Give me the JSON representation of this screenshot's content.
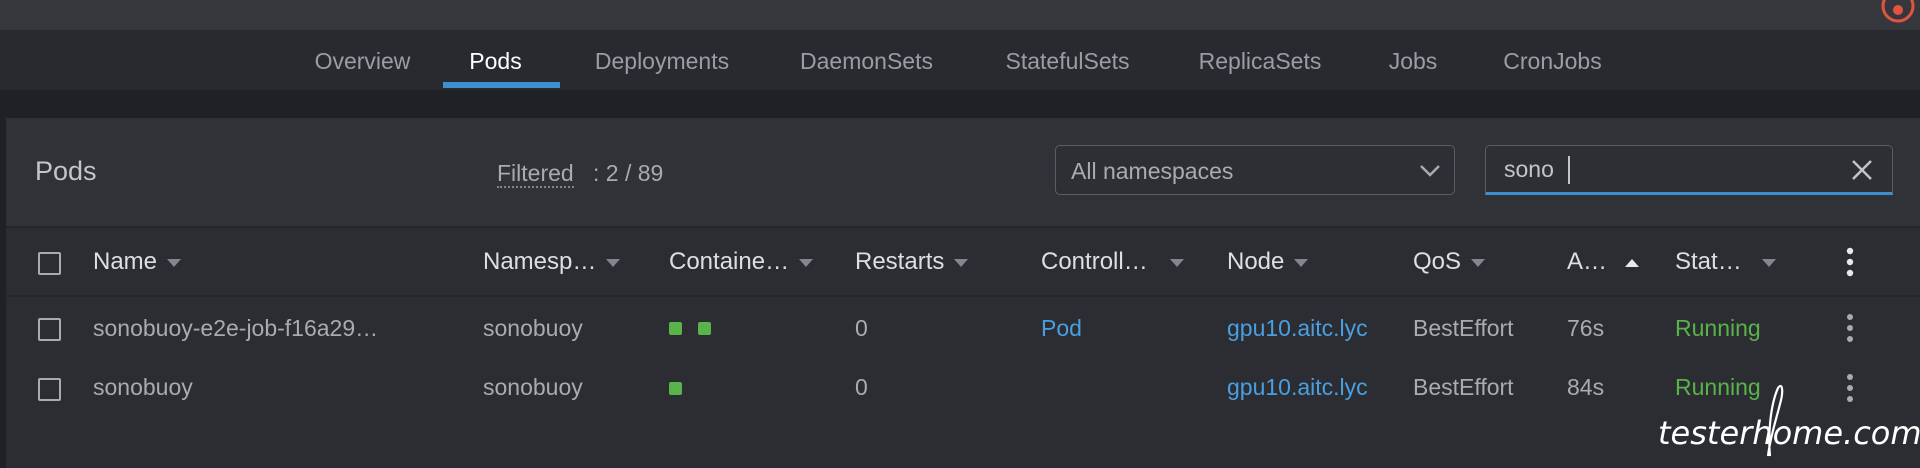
{
  "tabs": [
    {
      "label": "Overview"
    },
    {
      "label": "Pods"
    },
    {
      "label": "Deployments"
    },
    {
      "label": "DaemonSets"
    },
    {
      "label": "StatefulSets"
    },
    {
      "label": "ReplicaSets"
    },
    {
      "label": "Jobs"
    },
    {
      "label": "CronJobs"
    }
  ],
  "active_tab": "Pods",
  "panel": {
    "title": "Pods",
    "filter_label": "Filtered",
    "filter_count": ": 2 / 89",
    "namespace_select": "All namespaces",
    "search_value": "sono"
  },
  "table": {
    "columns": [
      {
        "label": "Name",
        "sort": "none"
      },
      {
        "label": "Namesp…",
        "sort": "none"
      },
      {
        "label": "Containe…",
        "sort": "none"
      },
      {
        "label": "Restarts",
        "sort": "none"
      },
      {
        "label": "Controll…",
        "sort": "none"
      },
      {
        "label": "Node",
        "sort": "none"
      },
      {
        "label": "QoS",
        "sort": "none"
      },
      {
        "label": "A…",
        "sort": "ascending"
      },
      {
        "label": "Stat…",
        "sort": "none"
      }
    ],
    "rows": [
      {
        "name": "sonobuoy-e2e-job-f16a29…",
        "namespace": "sonobuoy",
        "containers": 2,
        "restarts": "0",
        "controlled_by": "Pod",
        "node": "gpu10.aitc.lyc",
        "qos": "BestEffort",
        "age": "76s",
        "status": "Running"
      },
      {
        "name": "sonobuoy",
        "namespace": "sonobuoy",
        "containers": 1,
        "restarts": "0",
        "controlled_by": "",
        "node": "gpu10.aitc.lyc",
        "qos": "BestEffort",
        "age": "84s",
        "status": "Running"
      }
    ]
  },
  "watermark": "testerhome.com",
  "icons": {
    "avatar": "avatar-icon",
    "namespace_dropdown": "chevron-down-icon",
    "search_clear": "close-icon",
    "column_sort": "caret-down-icon",
    "row_menu": "kebab-menu-icon"
  },
  "colors": {
    "accent": "#3d90ce",
    "link": "#4a9fe0",
    "status_running": "#59b34b",
    "container_ready": "#59b34b",
    "avatar": "#e0553f"
  }
}
